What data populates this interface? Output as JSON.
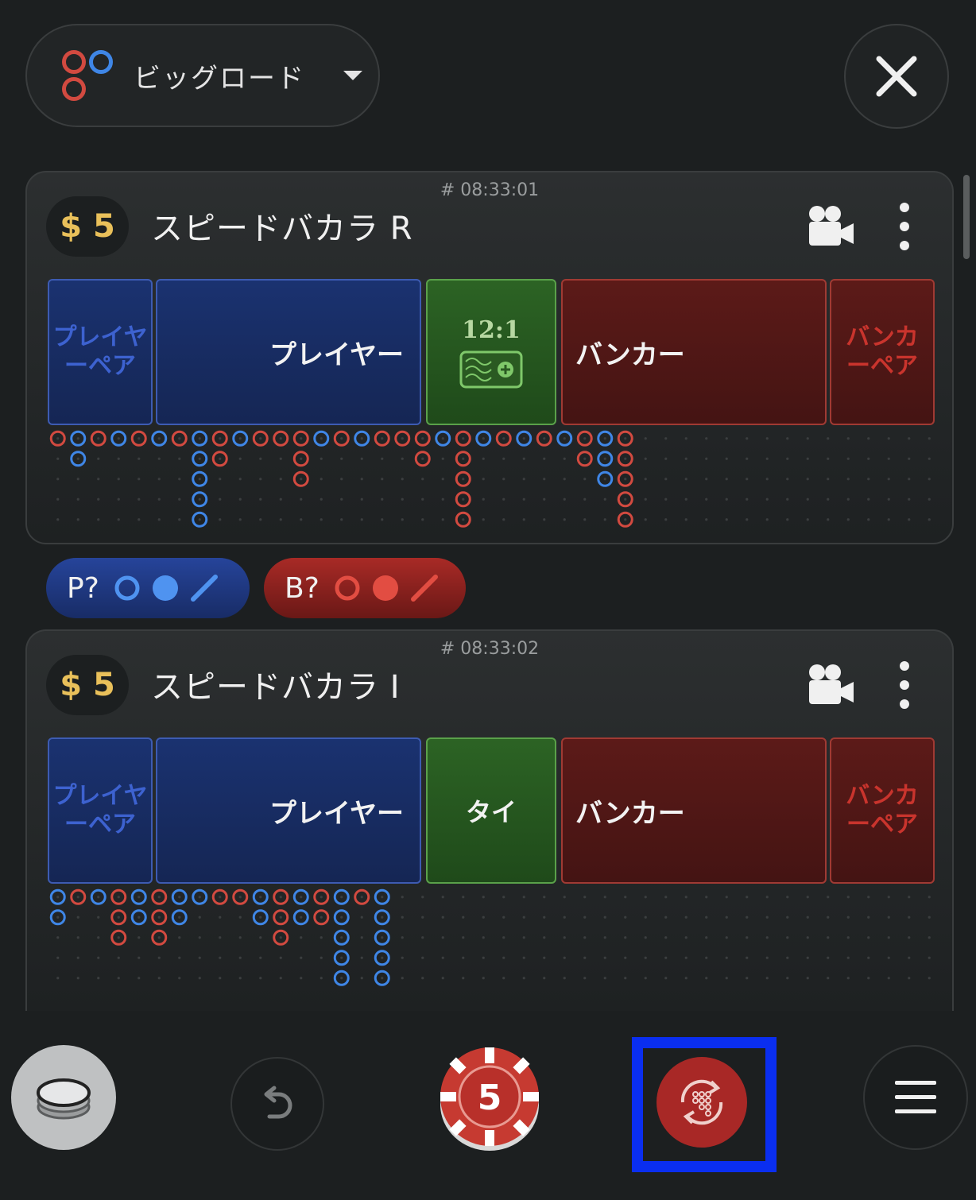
{
  "header": {
    "view_selector": "ビッグロード",
    "close_label": "close"
  },
  "colors": {
    "player": "#3f86e6",
    "banker": "#d24a40",
    "tie": "#5aa14a",
    "limit_gold": "#e9c05a",
    "highlight": "#0a2ef0"
  },
  "tables": [
    {
      "round_id": "# 08:33:01",
      "limit": "$ 5",
      "name": "スピードバカラ R",
      "bets": {
        "player_pair": "プレイヤーペア",
        "player": "プレイヤー",
        "tie": "12:1",
        "banker": "バンカー",
        "banker_pair": "バンカーペア"
      }
    },
    {
      "round_id": "# 08:33:02",
      "limit": "$ 5",
      "name": "スピードバカラ I",
      "bets": {
        "player_pair": "プレイヤーペア",
        "player": "プレイヤー",
        "tie": "タイ",
        "banker": "バンカー",
        "banker_pair": "バンカーペア"
      }
    }
  ],
  "roads": [
    [
      [
        "B"
      ],
      [
        "P",
        "P"
      ],
      [
        "B"
      ],
      [
        "P"
      ],
      [
        "B"
      ],
      [
        "P"
      ],
      [
        "B"
      ],
      [
        "P",
        "P",
        "P",
        "P",
        "P"
      ],
      [
        "B",
        "B"
      ],
      [
        "P"
      ],
      [
        "B"
      ],
      [
        "B"
      ],
      [
        "B",
        "B",
        "B"
      ],
      [
        "P"
      ],
      [
        "B"
      ],
      [
        "P"
      ],
      [
        "B"
      ],
      [
        "B"
      ],
      [
        "B",
        "B"
      ],
      [
        "P"
      ],
      [
        "B",
        "B",
        "B",
        "B",
        "B"
      ],
      [
        "P"
      ],
      [
        "B"
      ],
      [
        "P"
      ],
      [
        "B"
      ],
      [
        "P"
      ],
      [
        "B",
        "B"
      ],
      [
        "P",
        "P",
        "P"
      ],
      [
        "B",
        "B",
        "B",
        "B",
        "B"
      ]
    ],
    [
      [
        "P",
        "P"
      ],
      [
        "B"
      ],
      [
        "P"
      ],
      [
        "B",
        "B",
        "B"
      ],
      [
        "P",
        "P"
      ],
      [
        "B",
        "B",
        "B"
      ],
      [
        "P",
        "P"
      ],
      [
        "P"
      ],
      [
        "B"
      ],
      [
        "B"
      ],
      [
        "P",
        "P"
      ],
      [
        "B",
        "B",
        "B"
      ],
      [
        "P",
        "P"
      ],
      [
        "B",
        "B"
      ],
      [
        "P",
        "P",
        "P",
        "P",
        "P"
      ],
      [
        "B"
      ],
      [
        "P",
        "P",
        "P",
        "P",
        "P"
      ]
    ]
  ],
  "predictions": {
    "player": "P?",
    "banker": "B?"
  },
  "bottom_bar": {
    "chip_value": "5"
  }
}
